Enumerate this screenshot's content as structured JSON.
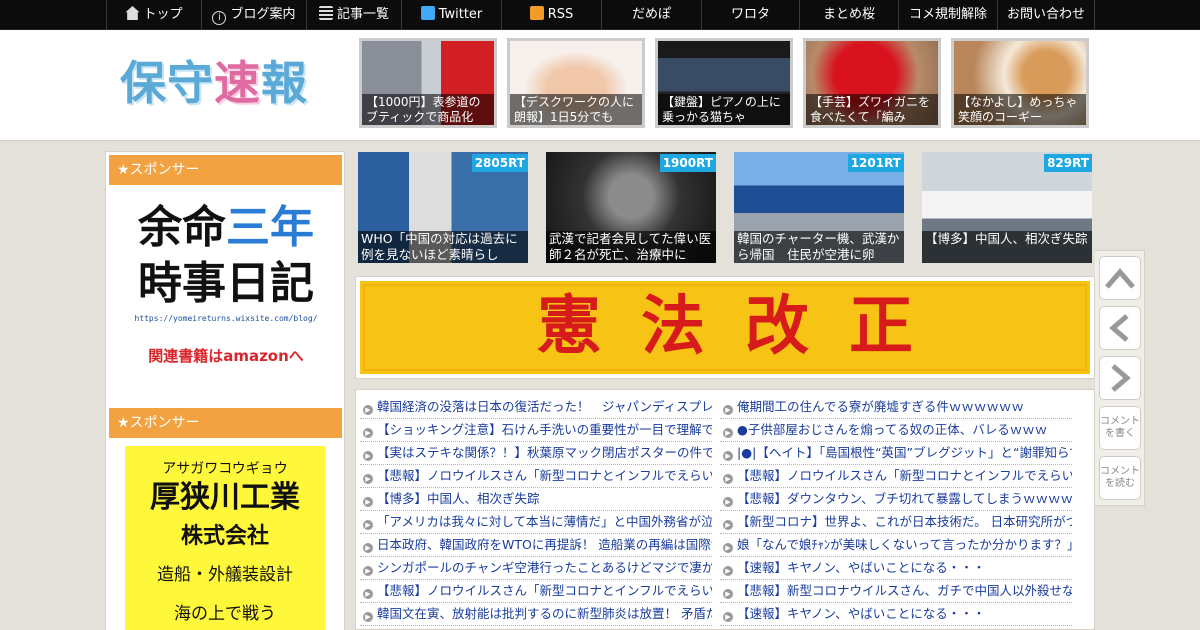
{
  "nav": [
    {
      "label": "トップ",
      "icon": "home-icon"
    },
    {
      "label": "ブログ案内",
      "icon": "info-icon"
    },
    {
      "label": "記事一覧",
      "icon": "list-icon"
    },
    {
      "label": "Twitter",
      "icon": "twitter-icon"
    },
    {
      "label": "RSS",
      "icon": "rss-icon"
    },
    {
      "label": "だめぽ"
    },
    {
      "label": "ワロタ"
    },
    {
      "label": "まとめ桜"
    },
    {
      "label": "コメ規制解除"
    },
    {
      "label": "お問い合わせ"
    }
  ],
  "logo": {
    "part1": "保守",
    "part2": "速",
    "part3": "報"
  },
  "header_thumbs": [
    {
      "caption": "【1000円】表参道のブティックで商品化"
    },
    {
      "caption": "【デスクワークの人に朗報】1日5分でも"
    },
    {
      "caption": "【鍵盤】ピアノの上に乗っかる猫ちゃ"
    },
    {
      "caption": "【手芸】ズワイガニを食べたくて「編み"
    },
    {
      "caption": "【なかよし】めっちゃ笑顔のコーギー"
    }
  ],
  "featured": [
    {
      "rt": "2805RT",
      "caption": "WHO「中国の対応は過去に例を見ないほど素晴らし"
    },
    {
      "rt": "1900RT",
      "caption": "武漢で記者会見してた偉い医師２名が死亡、治療中に"
    },
    {
      "rt": "1201RT",
      "caption": "韓国のチャーター機、武漢から帰国　住民が空港に卵"
    },
    {
      "rt": "829RT",
      "caption": "【博多】中国人、相次ぎ失踪"
    }
  ],
  "sidebar": {
    "sponsor_label_1": "★スポンサー",
    "sponsor_label_2": "★スポンサー",
    "ad1": {
      "line1a": "余命",
      "line1b": "三年",
      "line2": "時事日記",
      "url": "https://yomeireturns.wixsite.com/blog/",
      "amazon": "関連書籍はamazonへ"
    },
    "ad2": {
      "kana": "アサガワコウギョウ",
      "company": "厚狭川工業",
      "kk": "株式会社",
      "business": "造船・外艤装設計",
      "sea": "海の上で戦う"
    }
  },
  "banner": {
    "text": "憲法改正"
  },
  "list_left": [
    "韓国経済の没落は日本の復活だった！　ジャパンディスプレイ",
    "【ショッキング注意】石けん手洗いの重要性が一目で理解でき",
    "【実はステキな関係？！】秋葉原マック閉店ポスターの件でマ",
    "【悲報】ノロウイルスさん「新型コロナとインフルでえらい盛",
    "【博多】中国人、相次ぎ失踪",
    "「アメリカは我々に対して本当に薄情だ」と中国外務省が泣き",
    "日本政府、韓国政府をWTOに再提訴！ 造船業の再編は国際協",
    "シンガポールのチャンギ空港行ったことあるけどマジで凄かっ",
    "【悲報】ノロウイルスさん「新型コロナとインフルでえらい盛",
    "韓国文在寅、放射能は批判するのに新型肺炎は放置！ 矛盾だら"
  ],
  "list_right": [
    "俺期間工の住んでる寮が廃墟すぎる件ｗｗｗｗｗｗ",
    "●子供部屋おじさんを煽ってる奴の正体、バレるｗｗｗ",
    "|●|【ヘイト】「島国根性“英国”ブレグジット」と“謝罪知らず",
    "【悲報】ノロウイルスさん「新型コロナとインフルでえらい盛",
    "【悲報】ダウンタウン、ブチ切れて暴露してしまうｗｗｗｗｗ",
    "【新型コロナ】世界よ、これが日本技術だ。 日本研究所がつい",
    "娘「なんで娘ﾁｬﾝが美味しくないって言ったか分かります？」",
    "【速報】キヤノン、やばいことになる・・・",
    "【悲報】新型コロナウイルスさん、ガチで中国人以外殺せない",
    "【速報】キヤノン、やばいことになる・・・"
  ],
  "tools": {
    "comment_write": "コメントを書く",
    "comment_read": "コメントを読む"
  },
  "colors": {
    "nav_bg": "#0c0c0c",
    "sponsor_orange": "#f2a241",
    "rt_blue": "#1fa7e2",
    "banner_yellow": "#f7c315",
    "banner_red": "#d71b1b",
    "link_blue": "#1a3c9c"
  }
}
